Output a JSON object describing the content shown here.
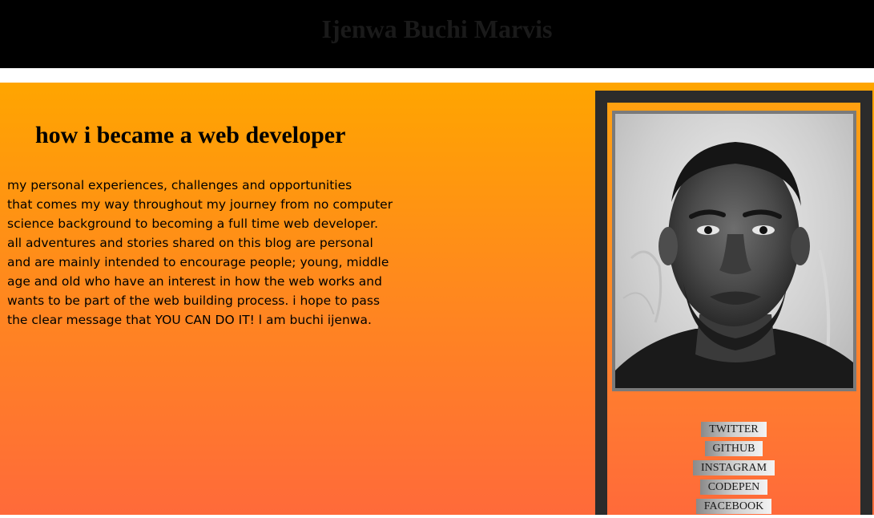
{
  "header": {
    "title": "Ijenwa Buchi Marvis"
  },
  "blog": {
    "heading": "how i became a web developer",
    "intro_lines": [
      "my personal experiences, challenges and opportunities",
      "that comes my way throughout my journey from no computer",
      "science background to becoming a full time web developer.",
      "all adventures and stories shared on this blog are personal",
      "and are mainly intended to encourage people; young, middle",
      "age and old who have an interest in how the web works and",
      "wants to be part of the web building process. i hope to pass",
      "the clear message that YOU CAN DO IT! l am buchi ijenwa."
    ]
  },
  "sidebar": {
    "social_links": [
      {
        "label": "TWITTER",
        "icon": "twitter-link"
      },
      {
        "label": "GITHUB",
        "icon": "github-link"
      },
      {
        "label": "INSTAGRAM",
        "icon": "instagram-link"
      },
      {
        "label": "CODEPEN",
        "icon": "codepen-link"
      },
      {
        "label": "FACEBOOK",
        "icon": "facebook-link"
      }
    ]
  },
  "colors": {
    "header_bg": "#000000",
    "gradient_top": "#ffa500",
    "gradient_bottom": "#ff6a3a",
    "sidebar_border": "#2b2b2b"
  }
}
